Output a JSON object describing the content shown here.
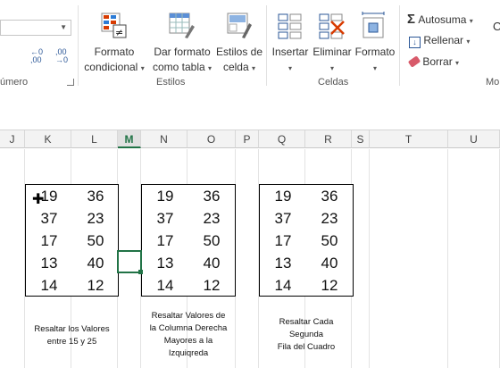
{
  "ribbon": {
    "number_group_label": "úmero",
    "styles_group_label": "Estilos",
    "cells_group_label": "Celdas",
    "editing_group_label_partial": "Mo",
    "formato_condicional": [
      "Formato",
      "condicional"
    ],
    "dar_formato_tabla": [
      "Dar formato",
      "como tabla"
    ],
    "estilos_celda": [
      "Estilos de",
      "celda"
    ],
    "insertar": "Insertar",
    "eliminar": "Eliminar",
    "formato": "Formato",
    "autosuma": "Autosuma",
    "rellenar": "Rellenar",
    "borrar": "Borrar",
    "partial_c": "O",
    "decimal_increase": "←0\n,00",
    "decimal_decrease": ",00\n→0"
  },
  "sheet": {
    "columns": [
      "J",
      "K",
      "L",
      "M",
      "N",
      "O",
      "P",
      "Q",
      "R",
      "S",
      "T",
      "U"
    ],
    "selected_column": "M",
    "table1": [
      [
        "19",
        "36"
      ],
      [
        "37",
        "23"
      ],
      [
        "17",
        "50"
      ],
      [
        "13",
        "40"
      ],
      [
        "14",
        "12"
      ]
    ],
    "table2": [
      [
        "19",
        "36"
      ],
      [
        "37",
        "23"
      ],
      [
        "17",
        "50"
      ],
      [
        "13",
        "40"
      ],
      [
        "14",
        "12"
      ]
    ],
    "table3": [
      [
        "19",
        "36"
      ],
      [
        "37",
        "23"
      ],
      [
        "17",
        "50"
      ],
      [
        "13",
        "40"
      ],
      [
        "14",
        "12"
      ]
    ],
    "notes": {
      "note1": [
        "Resaltar los Valores",
        "entre 15 y 25"
      ],
      "note2": [
        "Resaltar Valores de",
        "la Columna Derecha",
        "Mayores a la",
        "Izquiqreda"
      ],
      "note3": [
        "Resaltar Cada",
        "Segunda",
        "Fila del Cuadro"
      ]
    }
  },
  "colors": {
    "excel_green": "#217346",
    "delete_red": "#d83b01"
  }
}
